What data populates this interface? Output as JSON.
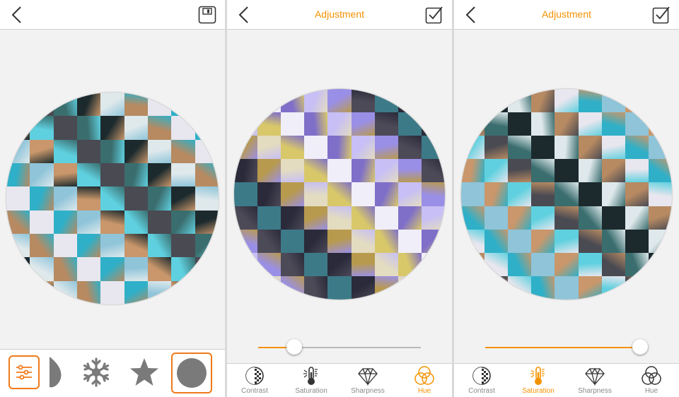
{
  "colors": {
    "accent": "#f39200",
    "tile_palette": [
      "#2fb0c8",
      "#5fd0df",
      "#1c2a2e",
      "#e8e6ee",
      "#c9976b",
      "#3a6d6e",
      "#b78a62",
      "#8fc4d9",
      "#4a4a52",
      "#dfe9ec"
    ],
    "tile_palette_purple": [
      "#9a8fe6",
      "#2a2a3a",
      "#d8c86a",
      "#c7bff5",
      "#3d7a88",
      "#e3dcc0",
      "#7f6fc9",
      "#4d4a58",
      "#b89a4e",
      "#f0eef8"
    ]
  },
  "screen1": {
    "toolbar_items": [
      {
        "icon": "adjust-sliders-icon",
        "selected": false
      },
      {
        "icon": "teardrop-shape-icon",
        "selected": false
      },
      {
        "icon": "snowflake-shape-icon",
        "selected": false
      },
      {
        "icon": "star-shape-icon",
        "selected": false
      },
      {
        "icon": "circle-shape-icon",
        "selected": true
      }
    ]
  },
  "screen2": {
    "title": "Adjustment",
    "slider_value": 0.22,
    "active_tab": "Hue"
  },
  "screen3": {
    "title": "Adjustment",
    "slider_value": 0.95,
    "active_tab": "Saturation"
  },
  "tabs": [
    {
      "label": "Contrast",
      "icon": "contrast-icon"
    },
    {
      "label": "Saturation",
      "icon": "thermometer-icon"
    },
    {
      "label": "Sharpness",
      "icon": "diamond-icon"
    },
    {
      "label": "Hue",
      "icon": "hue-circles-icon"
    }
  ]
}
